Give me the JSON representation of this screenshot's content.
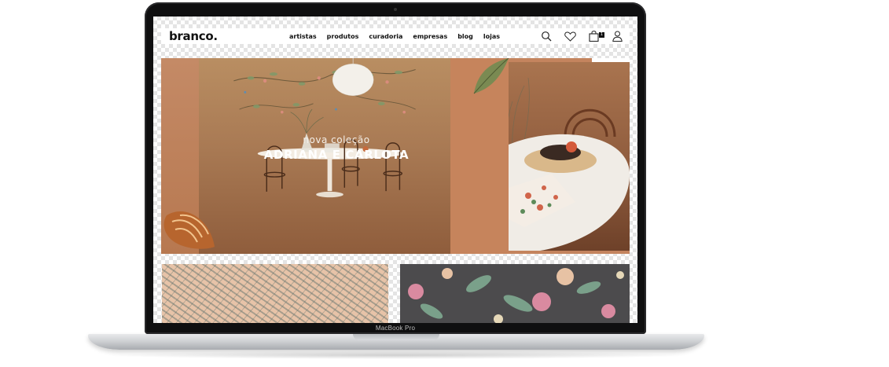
{
  "device": {
    "model_label": "MacBook Pro"
  },
  "header": {
    "logo": "branco.",
    "nav": [
      {
        "label": "artistas"
      },
      {
        "label": "produtos"
      },
      {
        "label": "curadoria"
      },
      {
        "label": "empresas"
      },
      {
        "label": "blog"
      },
      {
        "label": "lojas"
      }
    ],
    "icons": [
      "search-icon",
      "heart-icon",
      "bag-icon",
      "user-icon"
    ],
    "cart_count": "1"
  },
  "hero": {
    "subtitle": "nova coleção",
    "title": "ADRIANA E CARLOTA"
  },
  "colors": {
    "terracotta": "#c4845e",
    "text_dark": "#111111",
    "hero_text": "#ffffff",
    "tile_peach": "#e7c3a8",
    "tile_dark": "#4c4b4d"
  }
}
